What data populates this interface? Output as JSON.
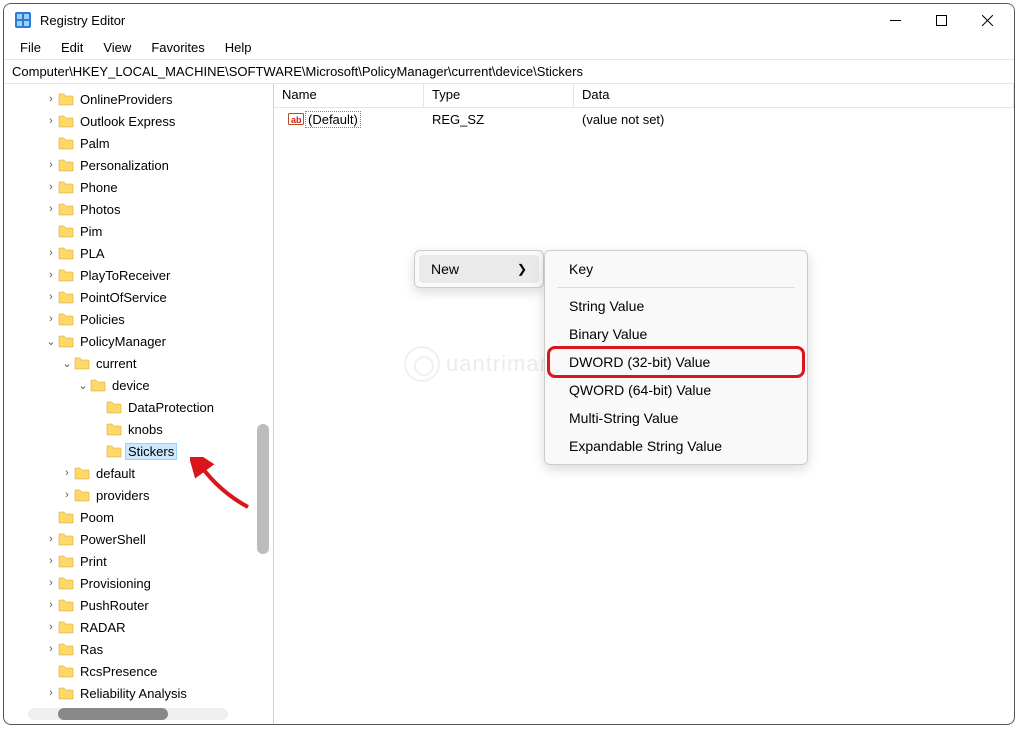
{
  "titlebar": {
    "title": "Registry Editor"
  },
  "menubar": {
    "file": "File",
    "edit": "Edit",
    "view": "View",
    "favorites": "Favorites",
    "help": "Help"
  },
  "addressbar": {
    "path": "Computer\\HKEY_LOCAL_MACHINE\\SOFTWARE\\Microsoft\\PolicyManager\\current\\device\\Stickers"
  },
  "tree": [
    {
      "indent": 2,
      "chev": ">",
      "label": "OnlineProviders"
    },
    {
      "indent": 2,
      "chev": ">",
      "label": "Outlook Express"
    },
    {
      "indent": 2,
      "chev": "",
      "label": "Palm"
    },
    {
      "indent": 2,
      "chev": ">",
      "label": "Personalization"
    },
    {
      "indent": 2,
      "chev": ">",
      "label": "Phone"
    },
    {
      "indent": 2,
      "chev": ">",
      "label": "Photos"
    },
    {
      "indent": 2,
      "chev": "",
      "label": "Pim"
    },
    {
      "indent": 2,
      "chev": ">",
      "label": "PLA"
    },
    {
      "indent": 2,
      "chev": ">",
      "label": "PlayToReceiver"
    },
    {
      "indent": 2,
      "chev": ">",
      "label": "PointOfService"
    },
    {
      "indent": 2,
      "chev": ">",
      "label": "Policies"
    },
    {
      "indent": 2,
      "chev": "v",
      "label": "PolicyManager"
    },
    {
      "indent": 3,
      "chev": "v",
      "label": "current"
    },
    {
      "indent": 4,
      "chev": "v",
      "label": "device"
    },
    {
      "indent": 5,
      "chev": "",
      "label": "DataProtection"
    },
    {
      "indent": 5,
      "chev": "",
      "label": "knobs"
    },
    {
      "indent": 5,
      "chev": "",
      "label": "Stickers",
      "selected": true
    },
    {
      "indent": 3,
      "chev": ">",
      "label": "default"
    },
    {
      "indent": 3,
      "chev": ">",
      "label": "providers"
    },
    {
      "indent": 2,
      "chev": "",
      "label": "Poom"
    },
    {
      "indent": 2,
      "chev": ">",
      "label": "PowerShell"
    },
    {
      "indent": 2,
      "chev": ">",
      "label": "Print"
    },
    {
      "indent": 2,
      "chev": ">",
      "label": "Provisioning"
    },
    {
      "indent": 2,
      "chev": ">",
      "label": "PushRouter"
    },
    {
      "indent": 2,
      "chev": ">",
      "label": "RADAR"
    },
    {
      "indent": 2,
      "chev": ">",
      "label": "Ras"
    },
    {
      "indent": 2,
      "chev": "",
      "label": "RcsPresence"
    },
    {
      "indent": 2,
      "chev": ">",
      "label": "Reliability Analysis"
    }
  ],
  "list": {
    "headers": {
      "name": "Name",
      "type": "Type",
      "data": "Data"
    },
    "rows": [
      {
        "name": "(Default)",
        "type": "REG_SZ",
        "data": "(value not set)"
      }
    ]
  },
  "context": {
    "new": "New",
    "sub": {
      "key": "Key",
      "string": "String Value",
      "binary": "Binary Value",
      "dword": "DWORD (32-bit) Value",
      "qword": "QWORD (64-bit) Value",
      "multi": "Multi-String Value",
      "expand": "Expandable String Value"
    }
  },
  "watermark": {
    "text": "uantrimang"
  }
}
